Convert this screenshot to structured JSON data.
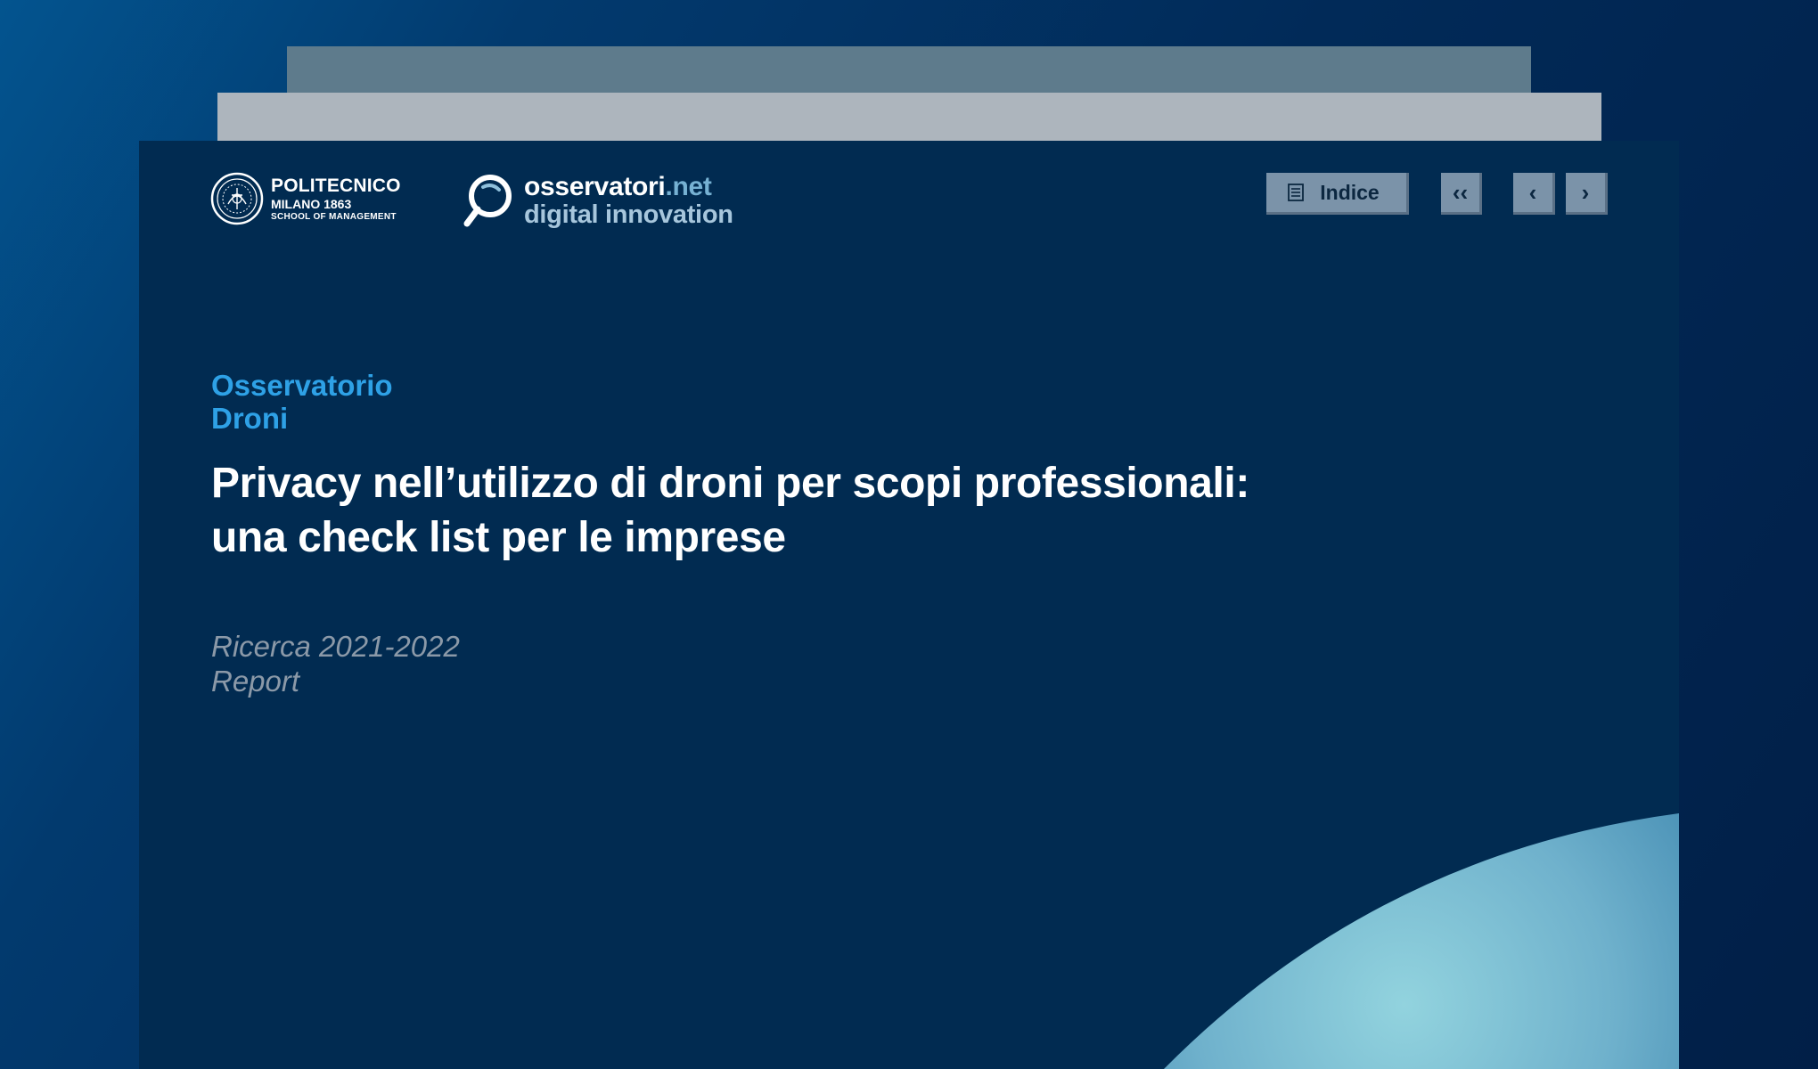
{
  "logos": {
    "polimi": {
      "name": "POLITECNICO",
      "city": "MILANO 1863",
      "school": "SCHOOL OF MANAGEMENT"
    },
    "osservatori": {
      "line1_main": "osservatori",
      "line1_suffix": ".net",
      "line2": "digital innovation"
    }
  },
  "toolbar": {
    "indice_label": "Indice",
    "first_glyph": "‹‹",
    "prev_glyph": "‹",
    "next_glyph": "›"
  },
  "report": {
    "kicker_line1": "Osservatorio",
    "kicker_line2": "Droni",
    "title_line1": "Privacy nell’utilizzo di droni per scopi professionali:",
    "title_line2": "una check list per le imprese",
    "meta_line1": "Ricerca 2021-2022",
    "meta_line2": "Report"
  },
  "icons": {
    "indice": "list-icon",
    "first": "double-chevron-left-icon",
    "prev": "chevron-left-icon",
    "next": "chevron-right-icon",
    "osservatori": "magnifier-icon",
    "polimi": "seal-icon"
  },
  "colors": {
    "card_bg": "#012b51",
    "kicker": "#2ea1e6",
    "title": "#ffffff",
    "meta": "#8b99a8",
    "button_bg": "#7b93a9"
  }
}
